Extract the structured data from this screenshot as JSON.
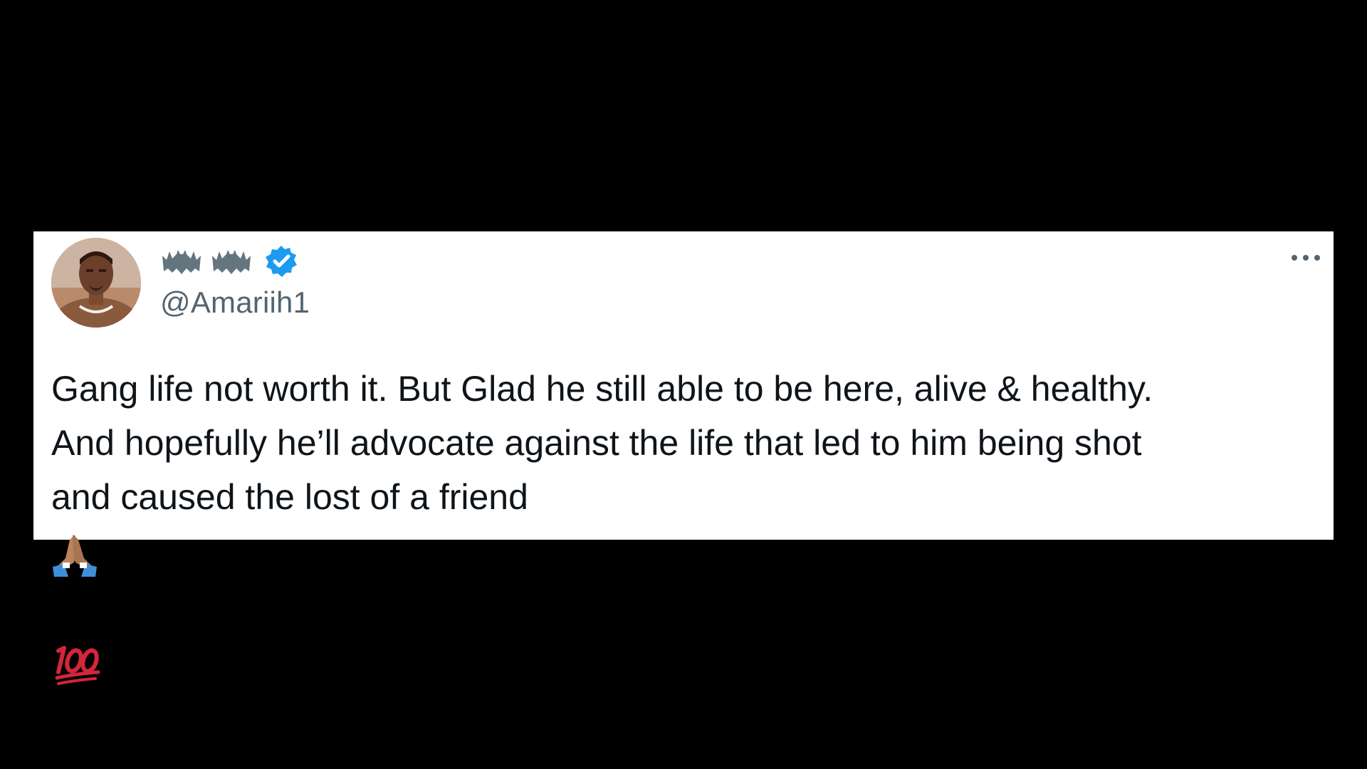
{
  "tweet": {
    "display_name_icons": [
      "bat-icon",
      "bat-icon"
    ],
    "verified": true,
    "handle": "@Amariih1",
    "text_lines": [
      "Gang life not worth it. But Glad he still able to be here, alive & healthy.",
      "And hopefully he’ll advocate against the life that led to him being shot",
      "and caused the lost of a friend"
    ],
    "emojis": [
      "folded-hands-icon",
      "hundred-points-icon"
    ],
    "more_icon": "more-options-icon"
  },
  "colors": {
    "background": "#000000",
    "card": "#ffffff",
    "text": "#0f1419",
    "handle": "#536471",
    "verified": "#1d9bf0",
    "hundred_points": "#d4253a"
  }
}
